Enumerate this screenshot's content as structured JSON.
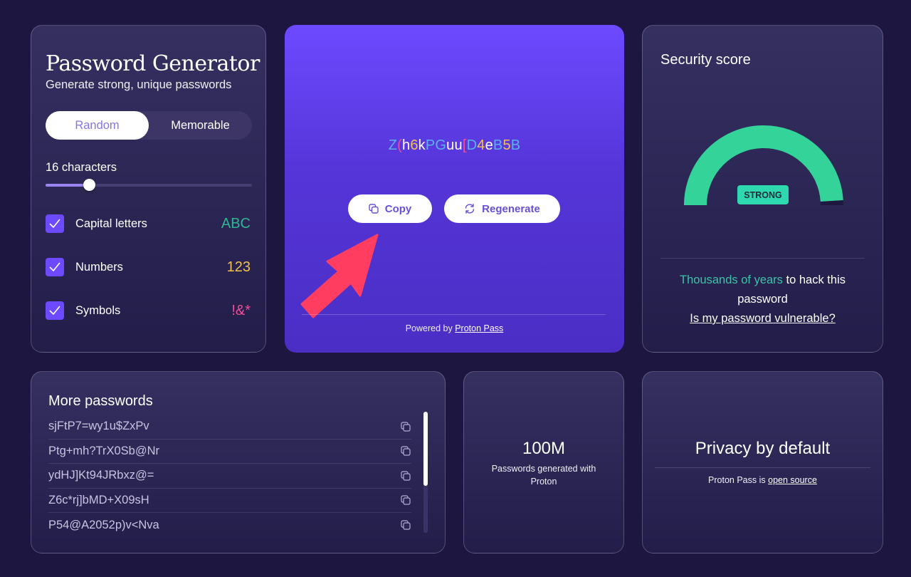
{
  "generator": {
    "title": "Password Generator",
    "subtitle": "Generate strong, unique passwords",
    "modes": [
      {
        "label": "Random",
        "active": true
      },
      {
        "label": "Memorable",
        "active": false
      }
    ],
    "length_label": "16 characters",
    "length_value": 16,
    "length_slider_fraction": 0.21,
    "options": [
      {
        "label": "Capital letters",
        "sample": "ABC",
        "checked": true,
        "color": "#2fb592"
      },
      {
        "label": "Numbers",
        "sample": "123",
        "checked": true,
        "color": "#f2c14e"
      },
      {
        "label": "Symbols",
        "sample": "!&*",
        "checked": true,
        "color": "#ef4f9a"
      }
    ]
  },
  "hero": {
    "password": "Z(h6kPGuu[D4eB5B",
    "password_chars": [
      {
        "c": "Z",
        "type": "upper"
      },
      {
        "c": "(",
        "type": "symbol"
      },
      {
        "c": "h",
        "type": "lower"
      },
      {
        "c": "6",
        "type": "number"
      },
      {
        "c": "k",
        "type": "lower"
      },
      {
        "c": "P",
        "type": "upper"
      },
      {
        "c": "G",
        "type": "upper"
      },
      {
        "c": "u",
        "type": "lower"
      },
      {
        "c": "u",
        "type": "lower"
      },
      {
        "c": "[",
        "type": "symbol"
      },
      {
        "c": "D",
        "type": "upper"
      },
      {
        "c": "4",
        "type": "number"
      },
      {
        "c": "e",
        "type": "lower"
      },
      {
        "c": "B",
        "type": "upper"
      },
      {
        "c": "5",
        "type": "number"
      },
      {
        "c": "B",
        "type": "upper"
      }
    ],
    "char_colors": {
      "upper": "#5ab0f0",
      "lower": "#ffffff",
      "number": "#f2c14e",
      "symbol": "#ef4f9a"
    },
    "copy_label": "Copy",
    "regenerate_label": "Regenerate",
    "powered_prefix": "Powered by ",
    "powered_link": "Proton Pass",
    "annotation_arrow_color": "#ff3d60"
  },
  "security": {
    "title": "Security score",
    "strength_label": "STRONG",
    "score_fraction": 0.98,
    "gauge_color": "#34d399",
    "crack_time_highlight": "Thousands of years",
    "crack_time_rest": " to hack this password",
    "vulnerable_link": "Is my password vulnerable?"
  },
  "more_passwords": {
    "title": "More passwords",
    "items": [
      "sjFtP7=wy1u$ZxPv",
      "Ptg+mh?TrX0Sb@Nr",
      "ydHJ]Kt94JRbxz@=",
      "Z6c*rj]bMD+X09sH",
      "P54@A2052p)v<Nva"
    ]
  },
  "stat": {
    "value": "100M",
    "caption": "Passwords generated with Proton"
  },
  "privacy": {
    "title": "Privacy by default",
    "sub_prefix": "Proton Pass is ",
    "sub_link": "open source"
  }
}
